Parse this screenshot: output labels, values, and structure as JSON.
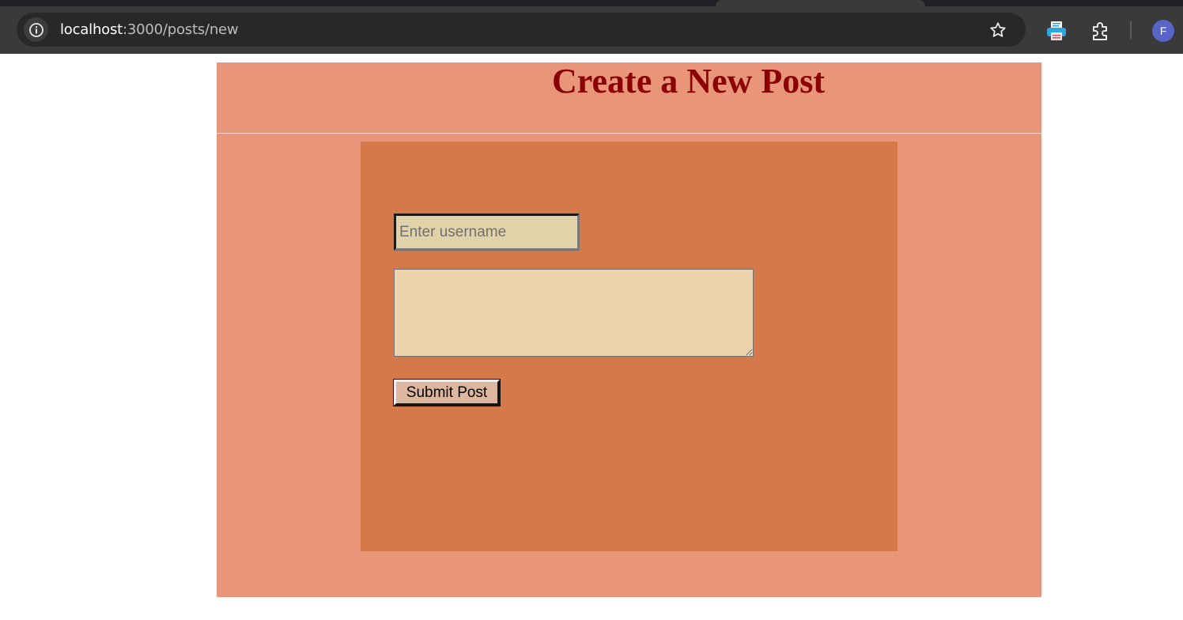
{
  "browser": {
    "url_host": "localhost",
    "url_path": ":3000/posts/new",
    "profile_initial": "F"
  },
  "page": {
    "title": "Create a New Post",
    "form": {
      "username_placeholder": "Enter username",
      "username_value": "",
      "content_value": "",
      "submit_label": "Submit Post"
    }
  },
  "colors": {
    "page_background": "#e99579",
    "form_panel": "#d6794a",
    "title_text": "#8b0000",
    "username_input_bg": "#e0d2a9",
    "textarea_bg": "#ebd4ab",
    "submit_button_bg": "#ddb79d"
  },
  "icons": {
    "site_info": "info-icon",
    "bookmark": "star-icon",
    "extension_1": "printer-extension-icon",
    "extension_2": "puzzle-icon"
  }
}
